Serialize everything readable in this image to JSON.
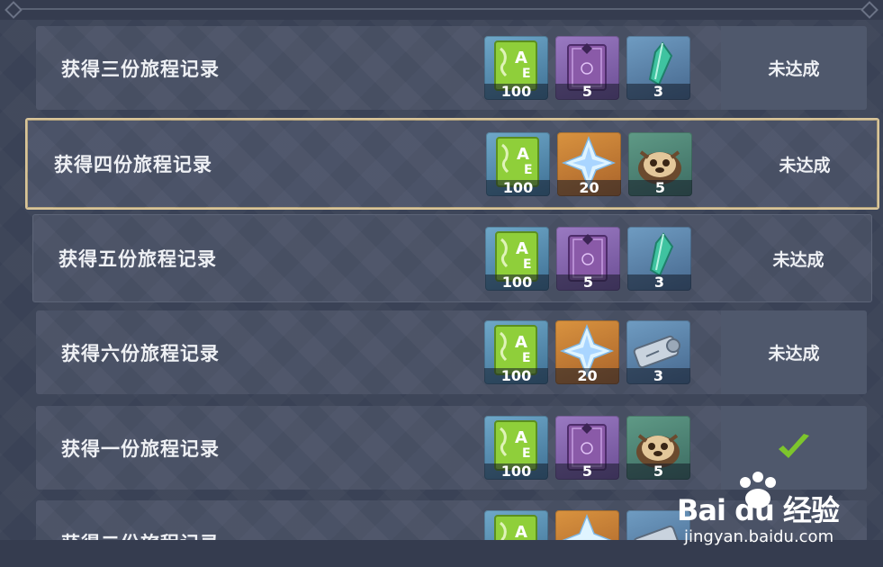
{
  "achievements": [
    {
      "title": "获得三份旅程记录",
      "status": "未达成",
      "rewards": [
        {
          "icon": "adventure-exp-icon",
          "count": "100"
        },
        {
          "icon": "heros-wit-book-icon",
          "count": "5"
        },
        {
          "icon": "crystal-chunk-icon",
          "count": "3"
        }
      ]
    },
    {
      "title": "获得四份旅程记录",
      "status": "未达成",
      "rewards": [
        {
          "icon": "adventure-exp-icon",
          "count": "100"
        },
        {
          "icon": "primogem-icon",
          "count": "20"
        },
        {
          "icon": "tanuki-figure-icon",
          "count": "5"
        }
      ]
    },
    {
      "title": "获得五份旅程记录",
      "status": "未达成",
      "rewards": [
        {
          "icon": "adventure-exp-icon",
          "count": "100"
        },
        {
          "icon": "heros-wit-book-icon",
          "count": "5"
        },
        {
          "icon": "crystal-chunk-icon",
          "count": "3"
        }
      ]
    },
    {
      "title": "获得六份旅程记录",
      "status": "未达成",
      "rewards": [
        {
          "icon": "adventure-exp-icon",
          "count": "100"
        },
        {
          "icon": "primogem-icon",
          "count": "20"
        },
        {
          "icon": "scroll-icon",
          "count": "3"
        }
      ]
    },
    {
      "title": "获得一份旅程记录",
      "status": "",
      "rewards": [
        {
          "icon": "adventure-exp-icon",
          "count": "100"
        },
        {
          "icon": "heros-wit-book-icon",
          "count": "5"
        },
        {
          "icon": "tanuki-figure-icon",
          "count": "5"
        }
      ]
    },
    {
      "title": "获得二份旅程记录",
      "status": "",
      "rewards": [
        {
          "icon": "adventure-exp-icon",
          "count": ""
        },
        {
          "icon": "primogem-icon",
          "count": ""
        },
        {
          "icon": "scroll-icon",
          "count": ""
        }
      ]
    }
  ],
  "watermark": {
    "brand": "Bai du 经验",
    "url": "jingyan.baidu.com"
  },
  "colors": {
    "check": "#7dc52c",
    "selected_border": "#d9c59a",
    "row_bg": "#4a5266"
  }
}
